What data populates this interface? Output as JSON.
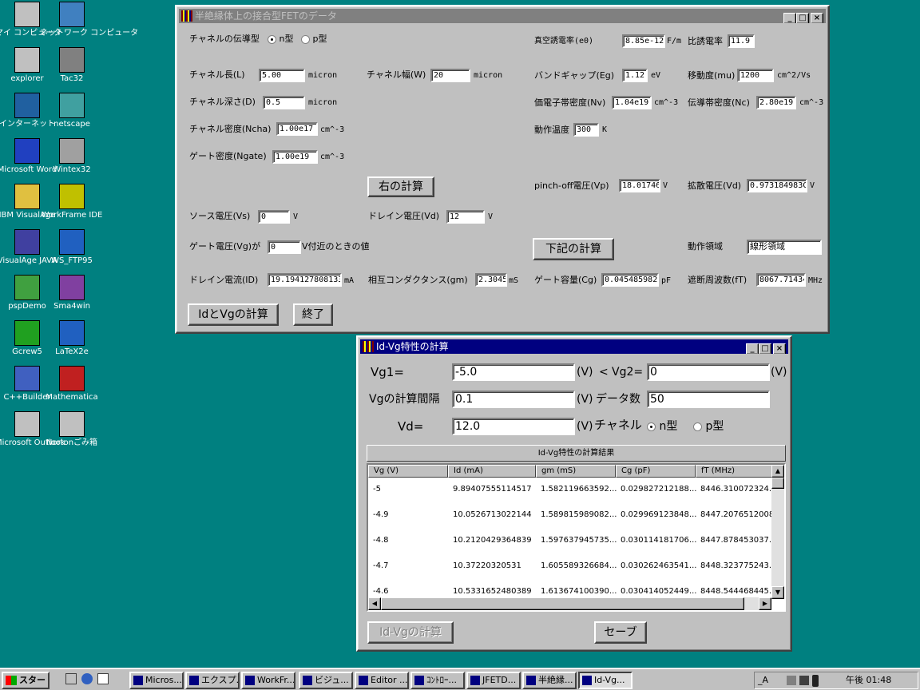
{
  "desktop": {
    "icons": [
      {
        "label": "マイ コンピュータ",
        "icon": "my-computer-icon"
      },
      {
        "label": "ネットワーク コンピュータ",
        "icon": "network-icon"
      },
      {
        "label": "explorer",
        "icon": "explorer-icon"
      },
      {
        "label": "Tac32",
        "icon": "tac32-icon"
      },
      {
        "label": "インターネット",
        "icon": "internet-icon"
      },
      {
        "label": "netscape",
        "icon": "netscape-icon"
      },
      {
        "label": "Microsoft Word",
        "icon": "word-icon"
      },
      {
        "label": "Wintex32",
        "icon": "wintex-icon"
      },
      {
        "label": "IBM VisualAge",
        "icon": "visualage-icon"
      },
      {
        "label": "WorkFrame IDE",
        "icon": "workframe-icon"
      },
      {
        "label": "VisualAge JAVA",
        "icon": "visualage-java-icon"
      },
      {
        "label": "WS_FTP95",
        "icon": "ftp-icon"
      },
      {
        "label": "pspDemo",
        "icon": "psp-icon"
      },
      {
        "label": "Sma4win",
        "icon": "sma4win-icon"
      },
      {
        "label": "Gcrew5",
        "icon": "gcrew-icon"
      },
      {
        "label": "LaTeX2e",
        "icon": "latex-icon"
      },
      {
        "label": "C++Builder",
        "icon": "cppbuilder-icon"
      },
      {
        "label": "Mathematica",
        "icon": "mathematica-icon"
      },
      {
        "label": "Microsoft Outlook",
        "icon": "outlook-icon"
      },
      {
        "label": "Nortonごみ箱",
        "icon": "recycle-icon"
      }
    ]
  },
  "win1": {
    "title": "半絶縁体上の接合型FETのデータ",
    "min": "_",
    "max": "□",
    "close": "×",
    "channel_type_label": "チャネルの伝導型",
    "n_label": "n型",
    "p_label": "p型",
    "e0_label": "真空誘電率(e0)",
    "e0_value": "8.85e-12",
    "e0_unit": "F/m",
    "er_label": "比誘電率",
    "er_value": "11.9",
    "L_label": "チャネル長(L)",
    "L_value": "5.00",
    "L_unit": "micron",
    "W_label": "チャネル幅(W)",
    "W_value": "20",
    "W_unit": "micron",
    "Eg_label": "バンドギャップ(Eg)",
    "Eg_value": "1.12",
    "Eg_unit": "eV",
    "mu_label": "移動度(mu)",
    "mu_value": "1200",
    "mu_unit": "cm^2/Vs",
    "D_label": "チャネル深さ(D)",
    "D_value": "0.5",
    "D_unit": "micron",
    "Nv_label": "価電子帯密度(Nv)",
    "Nv_value": "1.04e19",
    "Nv_unit": "cm^-3",
    "Nc_label": "伝導帯密度(Nc)",
    "Nc_value": "2.80e19",
    "Nc_unit": "cm^-3",
    "Ncha_label": "チャネル密度(Ncha)",
    "Ncha_value": "1.00e17",
    "Ncha_unit": "cm^-3",
    "T_label": "動作温度",
    "T_value": "300",
    "T_unit": "K",
    "Ngate_label": "ゲート密度(Ngate)",
    "Ngate_value": "1.00e19",
    "Ngate_unit": "cm^-3",
    "calc_right": "右の計算",
    "Vp_label": "pinch-off電圧(Vp)",
    "Vp_value": "18.01746",
    "Vp_unit": "V",
    "Vd_label": "拡散電圧(Vd)",
    "Vd_value": "0.973184983C",
    "Vd_unit": "V",
    "Vs_label": "ソース電圧(Vs)",
    "Vs_value": "0",
    "Vs_unit": "V",
    "Vdrain_label": "ドレイン電圧(Vd)",
    "Vdrain_value": "12",
    "Vdrain_unit": "V",
    "Vg_label": "ゲート電圧(Vg)が",
    "Vg_value": "0",
    "Vg_suffix": "V付近のときの値",
    "calc_below": "下記の計算",
    "region_label": "動作領域",
    "region_value": "線形領域",
    "ID_label": "ドレイン電流(ID)",
    "ID_value": "19.194127808133",
    "ID_unit": "mA",
    "gm_label": "相互コンダクタンス(gm)",
    "gm_value": "2.3045",
    "gm_unit": "mS",
    "Cg_label": "ゲート容量(Cg)",
    "Cg_value": "0.045485982",
    "Cg_unit": "pF",
    "fT_label": "遮断周波数(fT)",
    "fT_value": "8067.71434",
    "fT_unit": "MHz",
    "calc_idvg": "IdとVgの計算",
    "exit": "終了"
  },
  "win2": {
    "title": "Id-Vg特性の計算",
    "min": "_",
    "max": "□",
    "close": "×",
    "vg1_label": "Vg1=",
    "vg1_value": "-5.0",
    "vg1_unit": "(V)",
    "lt": "<",
    "vg2_label": "Vg2=",
    "vg2_value": "0",
    "vg2_unit": "(V)",
    "step_label": "Vgの計算間隔",
    "step_value": "0.1",
    "step_unit": "(V)",
    "count_label": "データ数",
    "count_value": "50",
    "vd_label": "Vd=",
    "vd_value": "12.0",
    "vd_unit": "(V)",
    "channel_label": "チャネル",
    "n_label": "n型",
    "p_label": "p型",
    "results_title": "Id-Vg特性の計算結果",
    "columns": [
      "Vg (V)",
      "Id (mA)",
      "gm (mS)",
      "Cg (pF)",
      "fT (MHz)"
    ],
    "rows": [
      [
        "-5",
        "9.89407555114517",
        "1.582119663592...",
        "0.029827212188...",
        "8446.310072324..."
      ],
      [
        "-4.9",
        "10.0526713022144",
        "1.589815989082...",
        "0.029969123848...",
        "8447.2076512008"
      ],
      [
        "-4.8",
        "10.2120429364839",
        "1.597637945735...",
        "0.030114181706...",
        "8447.878453037..."
      ],
      [
        "-4.7",
        "10.37220320531",
        "1.605589326684...",
        "0.030262463541...",
        "8448.323775243..."
      ],
      [
        "-4.6",
        "10.5331652480389",
        "1.613674100390...",
        "0.030414052449...",
        "8448.544468445..."
      ]
    ],
    "calc_btn": "Id-Vgの計算",
    "save_btn": "セーブ"
  },
  "taskbar": {
    "start": "スタート",
    "tasks": [
      "Micros...",
      "エクスプ...",
      "WorkFr...",
      "ビジュ...",
      "Editor ...",
      "ｺﾝﾄﾛｰ...",
      "JFETD...",
      "半絶縁...",
      "Id-Vg..."
    ],
    "tray_text": "_A",
    "clock": "午後 01:48"
  }
}
